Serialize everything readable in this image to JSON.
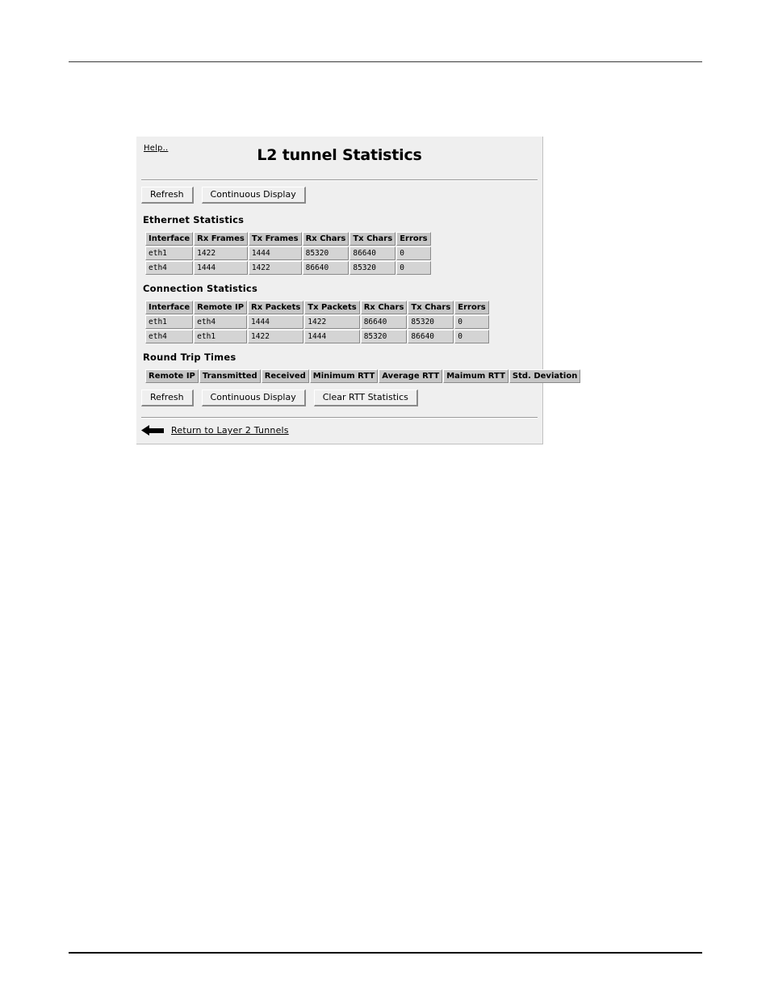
{
  "panel": {
    "help_label": "Help..",
    "title": "L2 tunnel Statistics"
  },
  "top_buttons": {
    "refresh": "Refresh",
    "continuous_display": "Continuous Display"
  },
  "ethernet_statistics": {
    "title": "Ethernet Statistics",
    "columns": [
      "Interface",
      "Rx Frames",
      "Tx Frames",
      "Rx Chars",
      "Tx Chars",
      "Errors"
    ],
    "rows": [
      [
        "eth1",
        "1422",
        "1444",
        "85320",
        "86640",
        "0"
      ],
      [
        "eth4",
        "1444",
        "1422",
        "86640",
        "85320",
        "0"
      ]
    ]
  },
  "connection_statistics": {
    "title": "Connection Statistics",
    "columns": [
      "Interface",
      "Remote IP",
      "Rx Packets",
      "Tx Packets",
      "Rx Chars",
      "Tx Chars",
      "Errors"
    ],
    "rows": [
      [
        "eth1",
        "eth4",
        "1444",
        "1422",
        "86640",
        "85320",
        "0"
      ],
      [
        "eth4",
        "eth1",
        "1422",
        "1444",
        "85320",
        "86640",
        "0"
      ]
    ]
  },
  "round_trip_times": {
    "title": "Round Trip Times",
    "columns": [
      "Remote IP",
      "Transmitted",
      "Received",
      "Minimum RTT",
      "Average RTT",
      "Maimum RTT",
      "Std. Deviation"
    ],
    "rows": []
  },
  "bottom_buttons": {
    "refresh": "Refresh",
    "continuous_display": "Continuous Display",
    "clear_rtt": "Clear RTT Statistics"
  },
  "footer": {
    "back_icon": "back-arrow-icon",
    "link_label": "Return to Layer 2 Tunnels"
  },
  "colors": {
    "panel_background": "#efefef",
    "table_header": "#c6c6c6",
    "table_cell": "#d4d4d4",
    "border_shadow": "#8a8a8a",
    "border_highlight": "#ffffff"
  }
}
